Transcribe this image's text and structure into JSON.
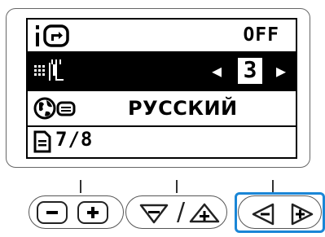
{
  "screen": {
    "row1": {
      "icon": "presser-foot-icon",
      "value": "OFF"
    },
    "row2": {
      "icon": "stitch-width-icon",
      "value": "3",
      "left_arrow": "◀",
      "right_arrow": "▶"
    },
    "row3": {
      "icon": "language-globe-icon",
      "value": "РУССКИЙ"
    },
    "row4": {
      "icon": "page-icon",
      "value": "7/8"
    }
  },
  "buttons": {
    "minus": "−",
    "plus": "+",
    "slash": "/"
  },
  "colors": {
    "highlight": "#1a86d6"
  }
}
